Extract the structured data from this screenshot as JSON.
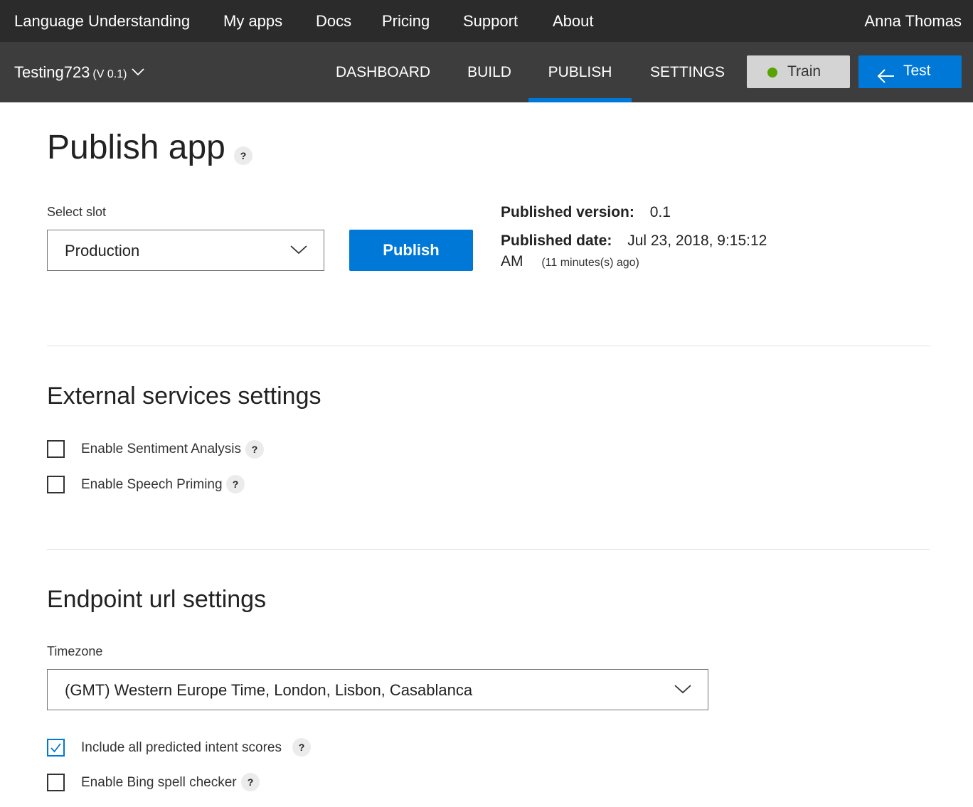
{
  "topnav": {
    "brand": "Language Understanding",
    "items": [
      "My apps",
      "Docs",
      "Pricing",
      "Support",
      "About"
    ],
    "user": "Anna Thomas"
  },
  "subnav": {
    "app_name": "Testing723",
    "app_version": "(V 0.1)",
    "tabs": [
      "DASHBOARD",
      "BUILD",
      "PUBLISH",
      "SETTINGS"
    ],
    "active_tab": "PUBLISH",
    "train_label": "Train",
    "test_label": "Test",
    "train_status_color": "#57a300",
    "accent_color": "#0078d7"
  },
  "publish": {
    "title": "Publish app",
    "help_glyph": "?",
    "select_slot_label": "Select slot",
    "slot_value": "Production",
    "publish_button": "Publish",
    "published_version_label": "Published version:",
    "published_version_value": "0.1",
    "published_date_label": "Published date:",
    "published_date_value": "Jul 23, 2018, 9:15:12",
    "published_date_value_cont": "AM",
    "published_ago": "(11 minutes(s) ago)"
  },
  "external": {
    "title": "External services settings",
    "options": [
      {
        "label": "Enable Sentiment Analysis",
        "checked": false
      },
      {
        "label": "Enable Speech Priming",
        "checked": false
      }
    ]
  },
  "endpoint": {
    "title": "Endpoint url settings",
    "timezone_label": "Timezone",
    "timezone_value": "(GMT) Western Europe Time, London, Lisbon, Casablanca",
    "options": [
      {
        "label": "Include all predicted intent scores",
        "checked": true
      },
      {
        "label": "Enable Bing spell checker",
        "checked": false
      }
    ]
  }
}
